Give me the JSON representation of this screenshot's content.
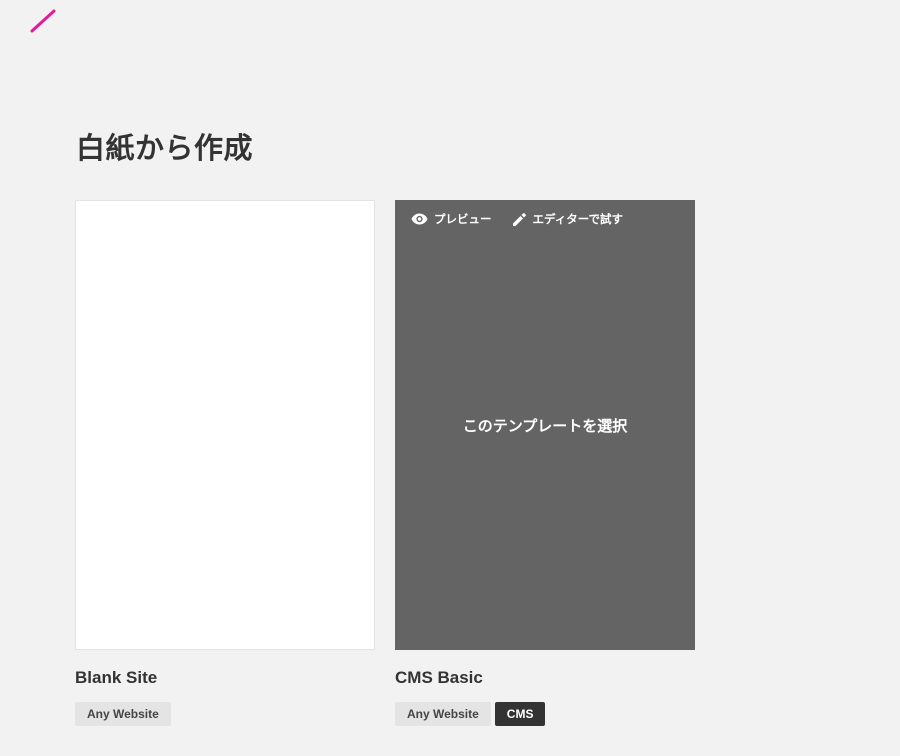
{
  "brand": {
    "logo_icon": "pen-stroke-logo",
    "color": "#e5199e"
  },
  "section": {
    "title": "白紙から作成"
  },
  "templates": [
    {
      "name": "Blank Site",
      "tags": [
        {
          "label": "Any Website",
          "active": false
        }
      ]
    },
    {
      "name": "CMS Basic",
      "overlay": {
        "preview_label": "プレビュー",
        "preview_icon": "eye-icon",
        "editor_label": "エディターで試す",
        "editor_icon": "pencil-icon",
        "select_label": "このテンプレートを選択"
      },
      "tags": [
        {
          "label": "Any Website",
          "active": false
        },
        {
          "label": "CMS",
          "active": true
        }
      ]
    }
  ],
  "colors": {
    "background": "#f2f2f2",
    "overlay": "#646464",
    "tag": "#e4e4e4",
    "tag_active": "#333333"
  }
}
